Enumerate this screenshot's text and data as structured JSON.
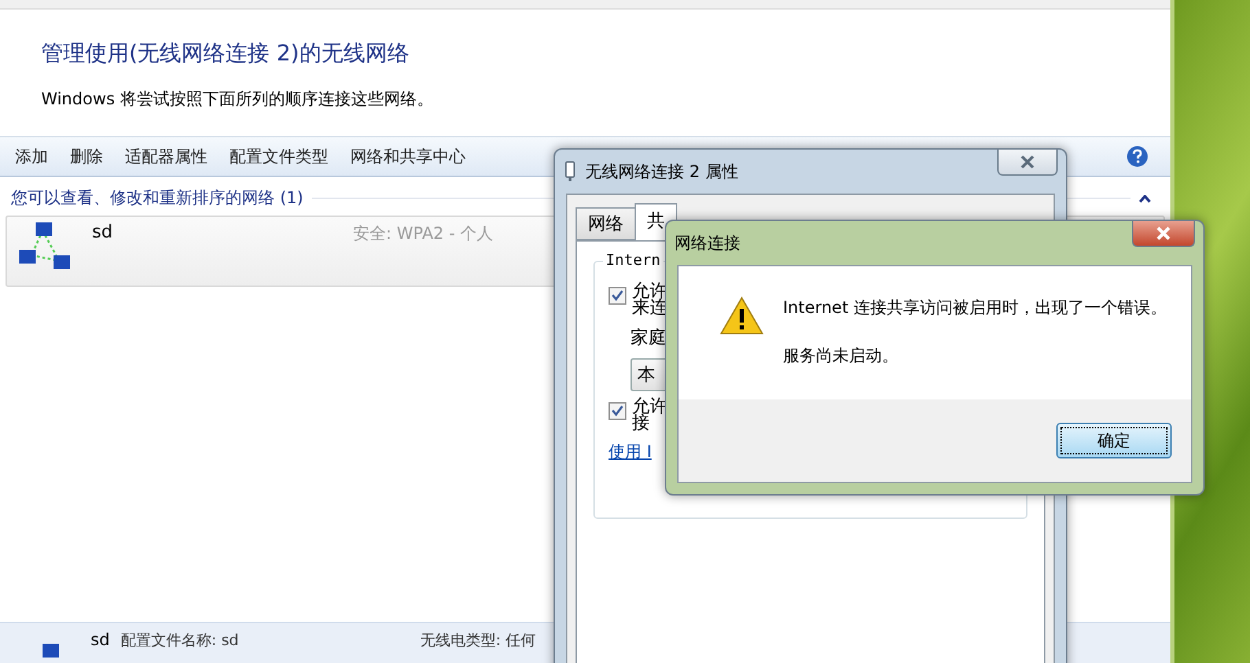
{
  "main_window": {
    "title": "管理使用(无线网络连接 2)的无线网络",
    "description": "Windows 将尝试按照下面所列的顺序连接这些网络。",
    "toolbar": [
      "添加",
      "删除",
      "适配器属性",
      "配置文件类型",
      "网络和共享中心"
    ],
    "group": {
      "title": "您可以查看、修改和重新排序的网络 (1)",
      "expanded": true
    },
    "networks": [
      {
        "name": "sd",
        "security": "安全: WPA2 - 个人",
        "selected": true
      }
    ],
    "details": {
      "name": "sd",
      "profile": "配置文件名称: sd",
      "radio_type": "无线电类型: 任何"
    }
  },
  "properties_dialog": {
    "title": "无线网络连接 2 属性",
    "tabs": [
      {
        "label": "网络",
        "selected": false
      },
      {
        "label": "共",
        "selected": true
      }
    ],
    "group_label": "Intern",
    "options": [
      {
        "kind": "checkbox",
        "lines": [
          "允许",
          "来连"
        ],
        "checked": true
      },
      {
        "kind": "label",
        "lines": [
          "家庭"
        ]
      },
      {
        "kind": "dropdown",
        "lines": [
          "本"
        ]
      },
      {
        "kind": "checkbox",
        "lines": [
          "允许",
          "接"
        ],
        "checked": true
      },
      {
        "kind": "link",
        "lines": [
          "使用 I"
        ]
      }
    ]
  },
  "error_dialog": {
    "title": "网络连接",
    "message": "Internet 连接共享访问被启用时，出现了一个错误。",
    "detail": "服务尚未启动。",
    "button": "确定"
  }
}
